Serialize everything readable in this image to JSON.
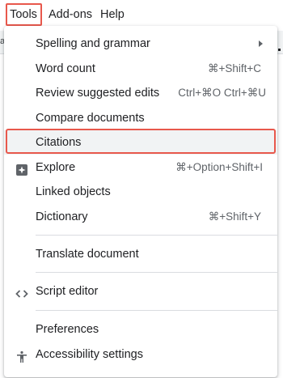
{
  "menubar": {
    "tools": "Tools",
    "addons": "Add-ons",
    "help": "Help"
  },
  "background": {
    "fragment": "al"
  },
  "colors": {
    "highlight": "#e8584c",
    "hover": "#f1f3f4",
    "text": "#202124",
    "shortcut": "#5f6368"
  },
  "menu": {
    "spelling": {
      "label": "Spelling and grammar",
      "has_submenu": true
    },
    "word_count": {
      "label": "Word count",
      "shortcut": "⌘+Shift+C"
    },
    "review": {
      "label": "Review suggested edits",
      "shortcut": "Ctrl+⌘O Ctrl+⌘U"
    },
    "compare": {
      "label": "Compare documents"
    },
    "citations": {
      "label": "Citations",
      "highlighted": true
    },
    "explore": {
      "label": "Explore",
      "shortcut": "⌘+Option+Shift+I",
      "icon": "explore-icon"
    },
    "linked": {
      "label": "Linked objects"
    },
    "dictionary": {
      "label": "Dictionary",
      "shortcut": "⌘+Shift+Y"
    },
    "translate": {
      "label": "Translate document"
    },
    "script": {
      "label": "Script editor",
      "icon": "code-brackets-icon"
    },
    "preferences": {
      "label": "Preferences"
    },
    "accessibility": {
      "label": "Accessibility settings",
      "icon": "accessibility-person-icon"
    }
  }
}
